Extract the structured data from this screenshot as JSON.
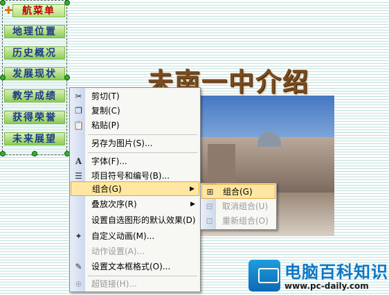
{
  "nav": {
    "title": "航菜单",
    "items": [
      "地理位置",
      "历史概况",
      "发展现状",
      "教学成绩",
      "获得荣誉",
      "未来展望"
    ]
  },
  "slide": {
    "title": "未南一中介绍"
  },
  "context_menu": {
    "items": [
      {
        "label": "剪切(T)",
        "icon": "scissors-icon"
      },
      {
        "label": "复制(C)",
        "icon": "copy-icon"
      },
      {
        "label": "粘贴(P)",
        "icon": "paste-icon"
      },
      {
        "label": "另存为图片(S)...",
        "icon": ""
      },
      {
        "label": "字体(F)...",
        "icon": "font-icon"
      },
      {
        "label": "项目符号和编号(B)...",
        "icon": "bullets-icon"
      },
      {
        "label": "组合(G)",
        "icon": "",
        "submenu": true
      },
      {
        "label": "叠放次序(R)",
        "icon": "",
        "submenu": true
      },
      {
        "label": "设置自选图形的默认效果(D)",
        "icon": ""
      },
      {
        "label": "自定义动画(M)...",
        "icon": "animation-icon"
      },
      {
        "label": "动作设置(A)...",
        "icon": "",
        "disabled": true
      },
      {
        "label": "设置文本框格式(O)...",
        "icon": "format-textbox-icon"
      },
      {
        "label": "超链接(H)...",
        "icon": "hyperlink-icon",
        "disabled": true
      }
    ]
  },
  "submenu": {
    "items": [
      {
        "label": "组合(G)",
        "icon": "group-icon"
      },
      {
        "label": "取消组合(U)",
        "icon": "ungroup-icon",
        "disabled": true
      },
      {
        "label": "重新组合(O)",
        "icon": "regroup-icon",
        "disabled": true
      }
    ]
  },
  "watermark": {
    "name": "电脑百科知识",
    "url": "www.pc-daily.com"
  }
}
